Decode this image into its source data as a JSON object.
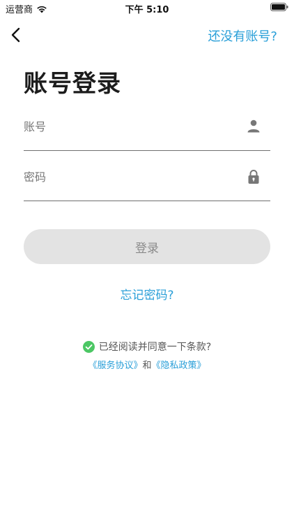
{
  "status_bar": {
    "carrier": "运营商",
    "time": "下午 5:10"
  },
  "nav": {
    "register_link": "还没有账号?"
  },
  "title": "账号登录",
  "form": {
    "account_placeholder": "账号",
    "password_placeholder": "密码",
    "login_button": "登录"
  },
  "forgot_password": "忘记密码?",
  "agreement": {
    "text": "已经阅读并同意一下条款?",
    "service_link": "《服务协议》",
    "connector": "和",
    "privacy_link": "《隐私政策》"
  },
  "icons": {
    "back": "chevron-left-icon",
    "account": "person-icon",
    "password": "lock-icon",
    "agree": "check-circle-icon"
  },
  "colors": {
    "accent": "#2a9fd8",
    "check": "#4cc764",
    "button_bg": "#e3e3e3",
    "button_text": "#8a8a8a"
  }
}
